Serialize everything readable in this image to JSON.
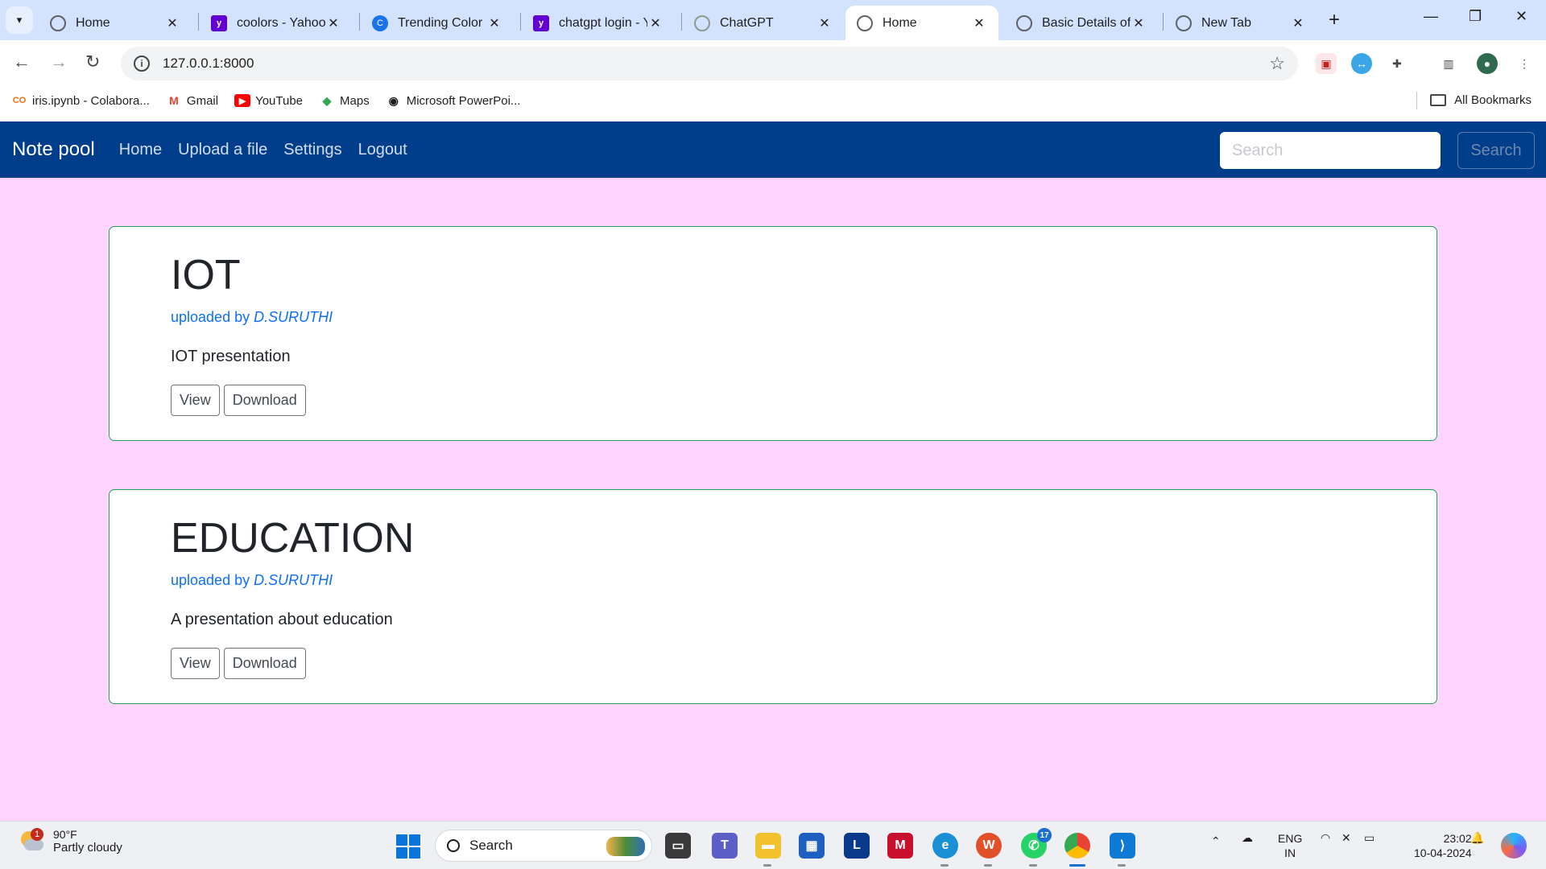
{
  "browser": {
    "tabs": [
      {
        "title": "Home",
        "icon": "globe-icon",
        "active": false
      },
      {
        "title": "coolors - Yahoo Search",
        "icon": "yahoo-icon",
        "active": false
      },
      {
        "title": "Trending Color Palettes",
        "icon": "coolors-icon",
        "active": false
      },
      {
        "title": "chatgpt login - Yahoo",
        "icon": "yahoo-icon",
        "active": false
      },
      {
        "title": "ChatGPT",
        "icon": "chatgpt-icon",
        "active": false
      },
      {
        "title": "Home",
        "icon": "globe-icon",
        "active": true
      },
      {
        "title": "Basic Details of the",
        "icon": "globe-icon",
        "active": false
      },
      {
        "title": "New Tab",
        "icon": "globe-icon",
        "active": false
      }
    ],
    "url": "127.0.0.1:8000",
    "bookmarks": [
      {
        "label": "iris.ipynb - Colabora...",
        "icon": "colab-icon"
      },
      {
        "label": "Gmail",
        "icon": "gmail-icon"
      },
      {
        "label": "YouTube",
        "icon": "youtube-icon"
      },
      {
        "label": "Maps",
        "icon": "maps-icon"
      },
      {
        "label": "Microsoft PowerPoi...",
        "icon": "globe-icon"
      }
    ],
    "all_bookmarks_label": "All Bookmarks"
  },
  "site": {
    "brand": "Note pool",
    "nav": [
      "Home",
      "Upload a file",
      "Settings",
      "Logout"
    ],
    "search_placeholder": "Search",
    "search_button": "Search"
  },
  "notes": [
    {
      "title": "IOT",
      "uploaded_by_prefix": "uploaded by",
      "uploader": "D.SURUTHI",
      "description": "IOT presentation",
      "view_label": "View",
      "download_label": "Download"
    },
    {
      "title": "EDUCATION",
      "uploaded_by_prefix": "uploaded by",
      "uploader": "D.SURUTHI",
      "description": "A presentation about education",
      "view_label": "View",
      "download_label": "Download"
    }
  ],
  "taskbar": {
    "weather_temp": "90°F",
    "weather_condition": "Partly cloudy",
    "weather_badge": "1",
    "search_label": "Search",
    "whatsapp_badge": "17",
    "language_line1": "ENG",
    "language_line2": "IN",
    "time": "23:02",
    "date": "10-04-2024"
  },
  "colors": {
    "page_background": "#ffd4ff",
    "navbar": "#003e8c",
    "card_border": "#20a25a",
    "link": "#0d6efd"
  }
}
